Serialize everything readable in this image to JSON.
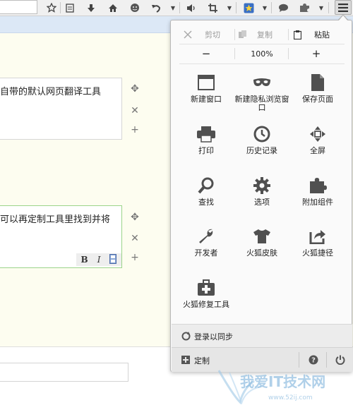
{
  "toolbar": {
    "icons": [
      "star-icon",
      "reading-list-icon",
      "download-icon",
      "home-icon",
      "chat-icon",
      "undo-icon",
      "dropdown-icon",
      "speaker-icon",
      "crop-icon",
      "dropdown-icon",
      "addon-icon",
      "dropdown-icon",
      "message-icon",
      "puzzle-icon",
      "dropdown-icon",
      "menu-icon"
    ]
  },
  "page": {
    "box1_text": "自带的默认网页翻译工具",
    "box2_text": "可以再定制工具里找到并将",
    "format": {
      "bold": "B",
      "italic": "I"
    }
  },
  "panel": {
    "edit": {
      "cut": "剪切",
      "copy": "复制",
      "paste": "粘贴"
    },
    "zoom": {
      "minus": "−",
      "level": "100%",
      "plus": "+"
    },
    "items": [
      {
        "label": "新建窗口",
        "icon": "new-window-icon"
      },
      {
        "label": "新建隐私浏览窗口",
        "icon": "private-mask-icon"
      },
      {
        "label": "保存页面",
        "icon": "save-page-icon"
      },
      {
        "label": "打印",
        "icon": "printer-icon"
      },
      {
        "label": "历史记录",
        "icon": "history-clock-icon"
      },
      {
        "label": "全屏",
        "icon": "fullscreen-icon"
      },
      {
        "label": "查找",
        "icon": "magnifier-icon"
      },
      {
        "label": "选项",
        "icon": "gear-icon"
      },
      {
        "label": "附加组件",
        "icon": "puzzle-icon"
      },
      {
        "label": "开发者",
        "icon": "wrench-icon"
      },
      {
        "label": "火狐皮肤",
        "icon": "tshirt-icon"
      },
      {
        "label": "火狐捷径",
        "icon": "share-arrow-icon"
      },
      {
        "label": "火狐修复工具",
        "icon": "first-aid-kit-icon"
      }
    ],
    "sync": "登录以同步",
    "customize": "定制"
  },
  "watermark": {
    "text": "我爱IT技术网",
    "url": "www.52ij.com"
  }
}
